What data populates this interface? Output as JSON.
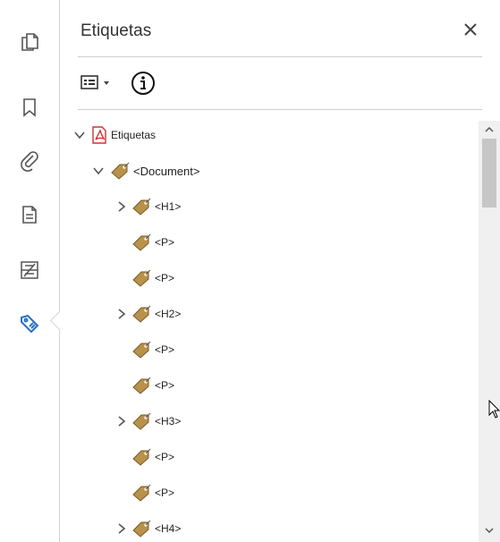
{
  "panel": {
    "title": "Etiquetas",
    "close_icon": "close-icon",
    "options_icon": "list-options-icon",
    "info_icon": "info-icon"
  },
  "left_rail": {
    "icons": [
      "pages-icon",
      "bookmark-icon",
      "attachment-icon",
      "document-properties-icon",
      "content-icon",
      "tags-icon"
    ],
    "active": "tags-icon",
    "accent_color": "#2a6fc4"
  },
  "tree": {
    "root": {
      "label": "Etiquetas",
      "icon": "pdf-icon",
      "expanded": true
    },
    "nodes": [
      {
        "label": "<Document>",
        "expanded": true
      },
      {
        "label": "<H1>",
        "expanded": false
      },
      {
        "label": "<P>"
      },
      {
        "label": "<P>"
      },
      {
        "label": "<H2>",
        "expanded": false
      },
      {
        "label": "<P>"
      },
      {
        "label": "<P>"
      },
      {
        "label": "<H3>",
        "expanded": false
      },
      {
        "label": "<P>"
      },
      {
        "label": "<P>"
      },
      {
        "label": "<H4>",
        "expanded": false
      }
    ],
    "tag_color": "#b8924a"
  }
}
